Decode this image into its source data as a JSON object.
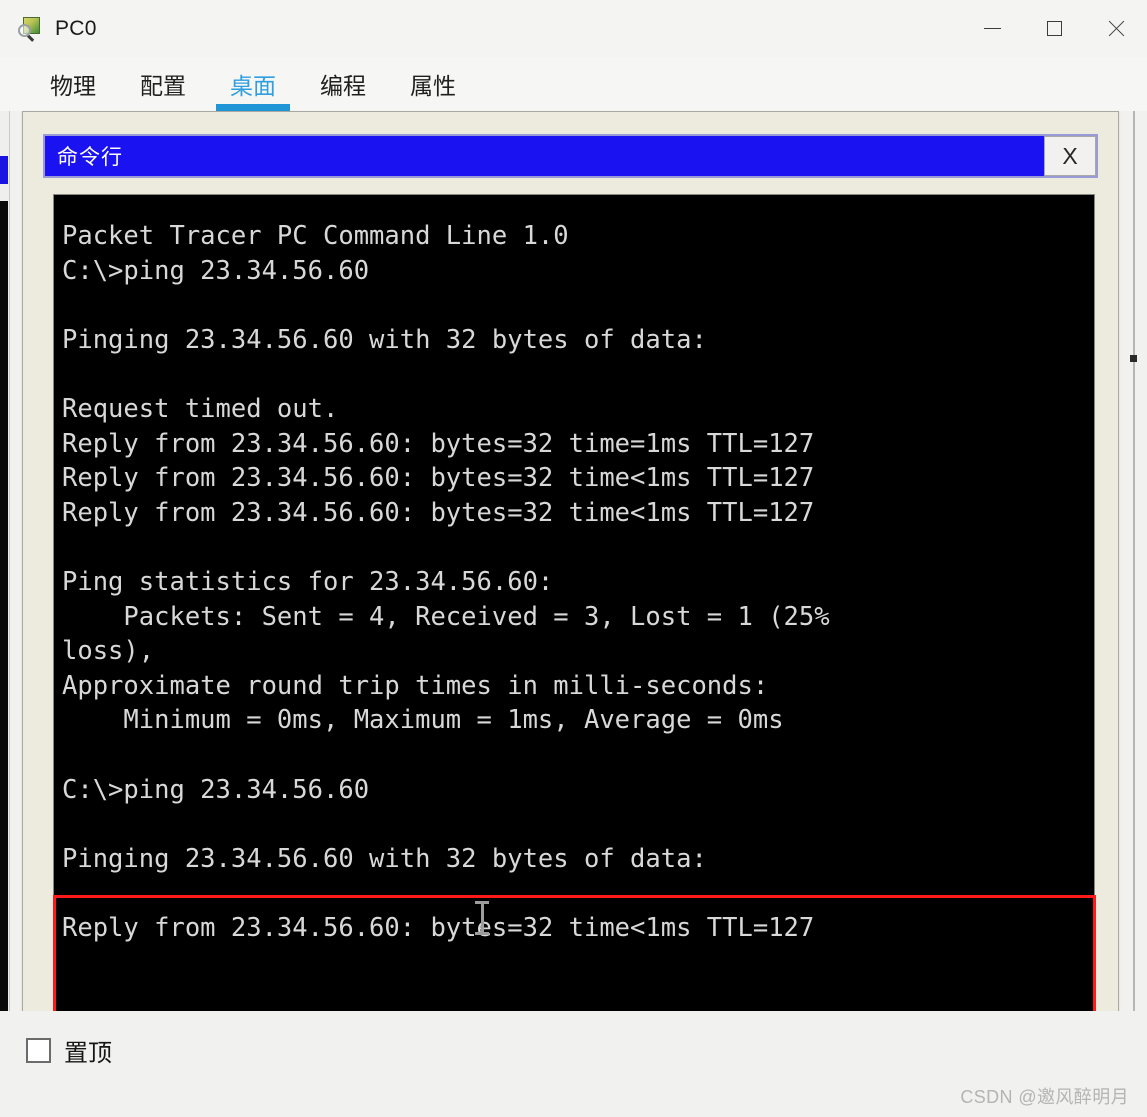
{
  "window": {
    "title": "PC0",
    "icon": "packet-tracer-icon",
    "controls": {
      "minimize": "—",
      "maximize": "☐",
      "close": "✕"
    }
  },
  "tabs": [
    {
      "label": "物理",
      "active": false
    },
    {
      "label": "配置",
      "active": false
    },
    {
      "label": "桌面",
      "active": true
    },
    {
      "label": "编程",
      "active": false
    },
    {
      "label": "属性",
      "active": false
    }
  ],
  "cmd_window": {
    "title": "命令行",
    "close_label": "X",
    "titlebar_color": "#1a12f0"
  },
  "terminal": {
    "background": "#000000",
    "foreground": "#d8d8d8",
    "text": "Packet Tracer PC Command Line 1.0\nC:\\>ping 23.34.56.60\n\nPinging 23.34.56.60 with 32 bytes of data:\n\nRequest timed out.\nReply from 23.34.56.60: bytes=32 time=1ms TTL=127\nReply from 23.34.56.60: bytes=32 time<1ms TTL=127\nReply from 23.34.56.60: bytes=32 time<1ms TTL=127\n\nPing statistics for 23.34.56.60:\n    Packets: Sent = 4, Received = 3, Lost = 1 (25%\nloss),\nApproximate round trip times in milli-seconds:\n    Minimum = 0ms, Maximum = 1ms, Average = 0ms\n\nC:\\>ping 23.34.56.60\n\nPinging 23.34.56.60 with 32 bytes of data:\n\nReply from 23.34.56.60: bytes=32 time<1ms TTL=127",
    "lines": [
      "Packet Tracer PC Command Line 1.0",
      "C:\\>ping 23.34.56.60",
      "",
      "Pinging 23.34.56.60 with 32 bytes of data:",
      "",
      "Request timed out.",
      "Reply from 23.34.56.60: bytes=32 time=1ms TTL=127",
      "Reply from 23.34.56.60: bytes=32 time<1ms TTL=127",
      "Reply from 23.34.56.60: bytes=32 time<1ms TTL=127",
      "",
      "Ping statistics for 23.34.56.60:",
      "    Packets: Sent = 4, Received = 3, Lost = 1 (25%",
      "loss),",
      "Approximate round trip times in milli-seconds:",
      "    Minimum = 0ms, Maximum = 1ms, Average = 0ms",
      "",
      "C:\\>ping 23.34.56.60",
      "",
      "Pinging 23.34.56.60 with 32 bytes of data:",
      "",
      "Reply from 23.34.56.60: bytes=32 time<1ms TTL=127"
    ],
    "highlight": {
      "color": "#ff1a1a",
      "note": "red rectangle around second ping session"
    }
  },
  "footer": {
    "pin_label": "置顶",
    "pin_checked": false
  },
  "watermark": "CSDN @邀风醉明月"
}
